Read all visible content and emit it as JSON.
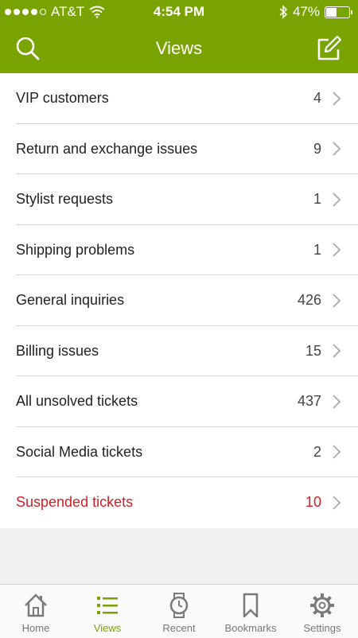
{
  "status": {
    "carrier": "AT&T",
    "time": "4:54 PM",
    "battery": "47%",
    "battery_level": 0.47,
    "signal_bars": 4
  },
  "nav": {
    "title": "Views",
    "search_icon": "search-icon",
    "compose_icon": "compose-icon"
  },
  "views": [
    {
      "label": "VIP customers",
      "count": "4"
    },
    {
      "label": "Return and exchange issues",
      "count": "9"
    },
    {
      "label": "Stylist requests",
      "count": "1"
    },
    {
      "label": "Shipping problems",
      "count": "1"
    },
    {
      "label": "General inquiries",
      "count": "426"
    },
    {
      "label": "Billing issues",
      "count": "15"
    },
    {
      "label": "All unsolved tickets",
      "count": "437"
    },
    {
      "label": "Social Media tickets",
      "count": "2"
    },
    {
      "label": "Suspended tickets",
      "count": "10",
      "alert": true
    }
  ],
  "tabs": [
    {
      "label": "Home",
      "icon": "home-icon"
    },
    {
      "label": "Views",
      "icon": "list-icon",
      "active": true
    },
    {
      "label": "Recent",
      "icon": "watch-icon"
    },
    {
      "label": "Bookmarks",
      "icon": "bookmark-icon"
    },
    {
      "label": "Settings",
      "icon": "gear-icon"
    }
  ],
  "colors": {
    "brand": "#78a300",
    "alert": "#cc2027"
  }
}
